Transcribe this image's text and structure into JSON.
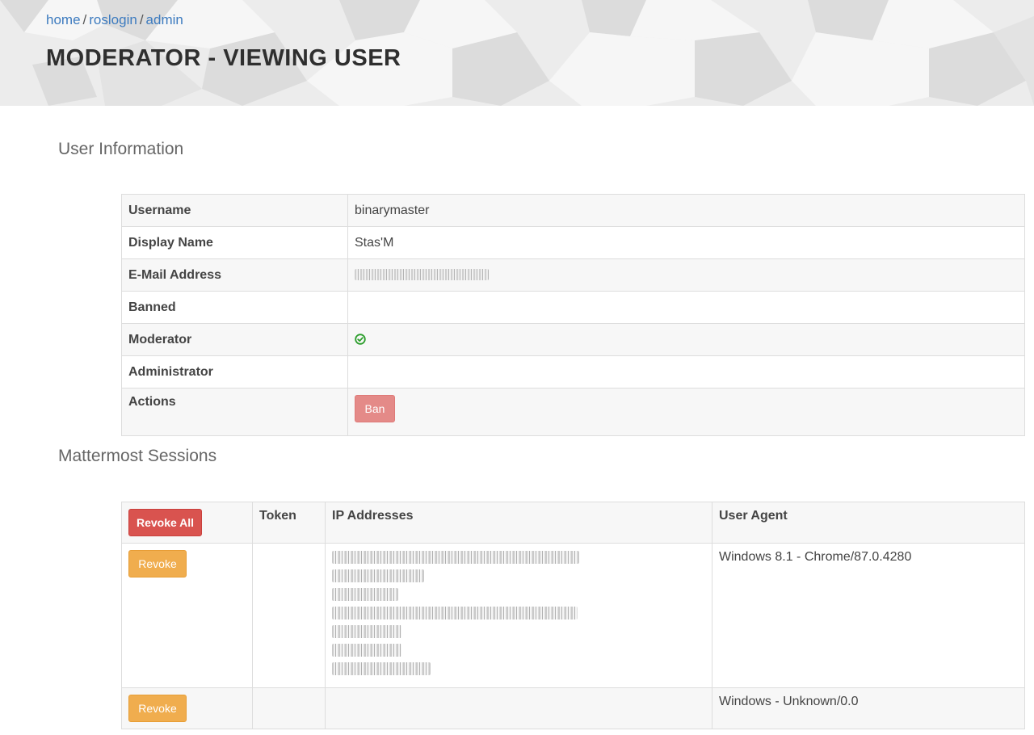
{
  "breadcrumb": {
    "items": [
      {
        "label": "home"
      },
      {
        "label": "roslogin"
      },
      {
        "label": "admin"
      }
    ],
    "separator": "/"
  },
  "page": {
    "title": "MODERATOR - VIEWING USER"
  },
  "user_info": {
    "section_title": "User Information",
    "rows": {
      "username": {
        "label": "Username",
        "value": "binarymaster"
      },
      "display_name": {
        "label": "Display Name",
        "value": "Stas'M"
      },
      "email": {
        "label": "E-Mail Address",
        "value": ""
      },
      "banned": {
        "label": "Banned",
        "value": ""
      },
      "moderator": {
        "label": "Moderator",
        "icon": "check-circle-icon"
      },
      "administrator": {
        "label": "Administrator",
        "value": ""
      },
      "actions": {
        "label": "Actions",
        "ban_button": "Ban"
      }
    }
  },
  "sessions": {
    "section_title": "Mattermost Sessions",
    "headers": {
      "revoke_all": "Revoke All",
      "token": "Token",
      "ip_addresses": "IP Addresses",
      "user_agent": "User Agent"
    },
    "rows": [
      {
        "revoke_label": "Revoke",
        "token": "",
        "user_agent": "Windows 8.1 - Chrome/87.0.4280"
      },
      {
        "revoke_label": "Revoke",
        "token": "",
        "user_agent": "Windows - Unknown/0.0"
      }
    ]
  },
  "colors": {
    "link": "#3d7bbf",
    "danger": "#d9534f",
    "danger_muted": "#e48a88",
    "warning": "#f0ad4e",
    "success": "#2a9d2a"
  }
}
